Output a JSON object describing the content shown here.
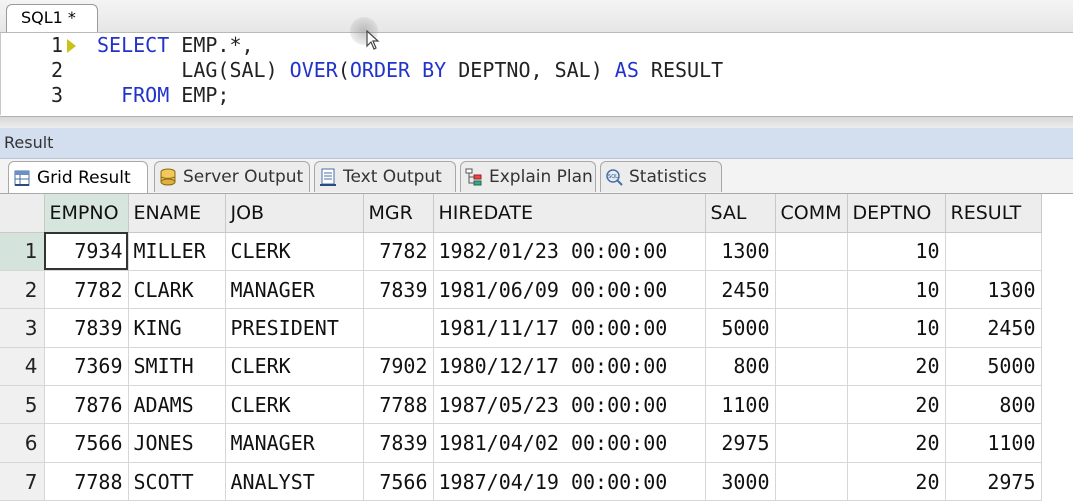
{
  "editor_tab": {
    "label": "SQL1 *"
  },
  "editor": {
    "lines": [
      {
        "num": "1",
        "parts": [
          {
            "t": "SELECT",
            "kw": true
          },
          {
            "t": " EMP.*,",
            "kw": false
          }
        ]
      },
      {
        "num": "2",
        "parts": [
          {
            "t": "       LAG(SAL) ",
            "kw": false
          },
          {
            "t": "OVER",
            "kw": true
          },
          {
            "t": "(",
            "kw": false
          },
          {
            "t": "ORDER BY",
            "kw": true
          },
          {
            "t": " DEPTNO, SAL) ",
            "kw": false
          },
          {
            "t": "AS",
            "kw": true
          },
          {
            "t": " RESULT",
            "kw": false
          }
        ]
      },
      {
        "num": "3",
        "parts": [
          {
            "t": "  FROM",
            "kw": true
          },
          {
            "t": " EMP;",
            "kw": false
          }
        ]
      }
    ]
  },
  "result_panel": {
    "title": "Result"
  },
  "result_tabs": [
    {
      "label": "Grid Result",
      "icon": "grid-icon",
      "active": true
    },
    {
      "label": "Server Output",
      "icon": "database-icon",
      "active": false
    },
    {
      "label": "Text Output",
      "icon": "text-doc-icon",
      "active": false
    },
    {
      "label": "Explain Plan",
      "icon": "tree-plan-icon",
      "active": false
    },
    {
      "label": "Statistics",
      "icon": "sql-magnifier-icon",
      "active": false
    }
  ],
  "grid": {
    "columns": [
      "EMPNO",
      "ENAME",
      "JOB",
      "MGR",
      "HIREDATE",
      "SAL",
      "COMM",
      "DEPTNO",
      "RESULT"
    ],
    "rows": [
      {
        "n": "1",
        "cells": [
          "7934",
          "MILLER",
          "CLERK",
          "7782",
          "1982/01/23 00:00:00",
          "1300",
          "",
          "10",
          ""
        ]
      },
      {
        "n": "2",
        "cells": [
          "7782",
          "CLARK",
          "MANAGER",
          "7839",
          "1981/06/09 00:00:00",
          "2450",
          "",
          "10",
          "1300"
        ]
      },
      {
        "n": "3",
        "cells": [
          "7839",
          "KING",
          "PRESIDENT",
          "",
          "1981/11/17 00:00:00",
          "5000",
          "",
          "10",
          "2450"
        ]
      },
      {
        "n": "4",
        "cells": [
          "7369",
          "SMITH",
          "CLERK",
          "7902",
          "1980/12/17 00:00:00",
          "800",
          "",
          "20",
          "5000"
        ]
      },
      {
        "n": "5",
        "cells": [
          "7876",
          "ADAMS",
          "CLERK",
          "7788",
          "1987/05/23 00:00:00",
          "1100",
          "",
          "20",
          "800"
        ]
      },
      {
        "n": "6",
        "cells": [
          "7566",
          "JONES",
          "MANAGER",
          "7839",
          "1981/04/02 00:00:00",
          "2975",
          "",
          "20",
          "1100"
        ]
      },
      {
        "n": "7",
        "cells": [
          "7788",
          "SCOTT",
          "ANALYST",
          "7566",
          "1987/04/19 00:00:00",
          "3000",
          "",
          "20",
          "2975"
        ]
      }
    ]
  }
}
